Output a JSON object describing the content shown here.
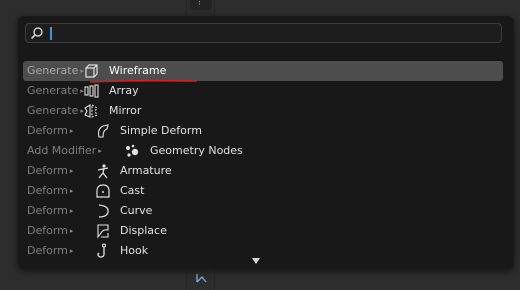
{
  "search": {
    "value": "",
    "placeholder": ""
  },
  "items": [
    {
      "prefix": "Generate",
      "label": "Wireframe",
      "icon": "wireframe-icon",
      "active": true
    },
    {
      "prefix": "Generate",
      "label": "Array",
      "icon": "array-icon",
      "active": false
    },
    {
      "prefix": "Generate",
      "label": "Mirror",
      "icon": "mirror-icon",
      "active": false
    },
    {
      "prefix": "Deform",
      "label": "Simple Deform",
      "icon": "simple-deform-icon",
      "active": false
    },
    {
      "prefix": "Add Modifier",
      "label": "Geometry Nodes",
      "icon": "geometry-nodes-icon",
      "active": false
    },
    {
      "prefix": "Deform",
      "label": "Armature",
      "icon": "armature-icon",
      "active": false
    },
    {
      "prefix": "Deform",
      "label": "Cast",
      "icon": "cast-icon",
      "active": false
    },
    {
      "prefix": "Deform",
      "label": "Curve",
      "icon": "curve-icon",
      "active": false
    },
    {
      "prefix": "Deform",
      "label": "Displace",
      "icon": "displace-icon",
      "active": false
    },
    {
      "prefix": "Deform",
      "label": "Hook",
      "icon": "hook-icon",
      "active": false
    }
  ],
  "colors": {
    "menu_bg": "#181818",
    "active_row": "#4d4d4d",
    "caret": "#4a8fe0",
    "underline": "#d42020"
  }
}
